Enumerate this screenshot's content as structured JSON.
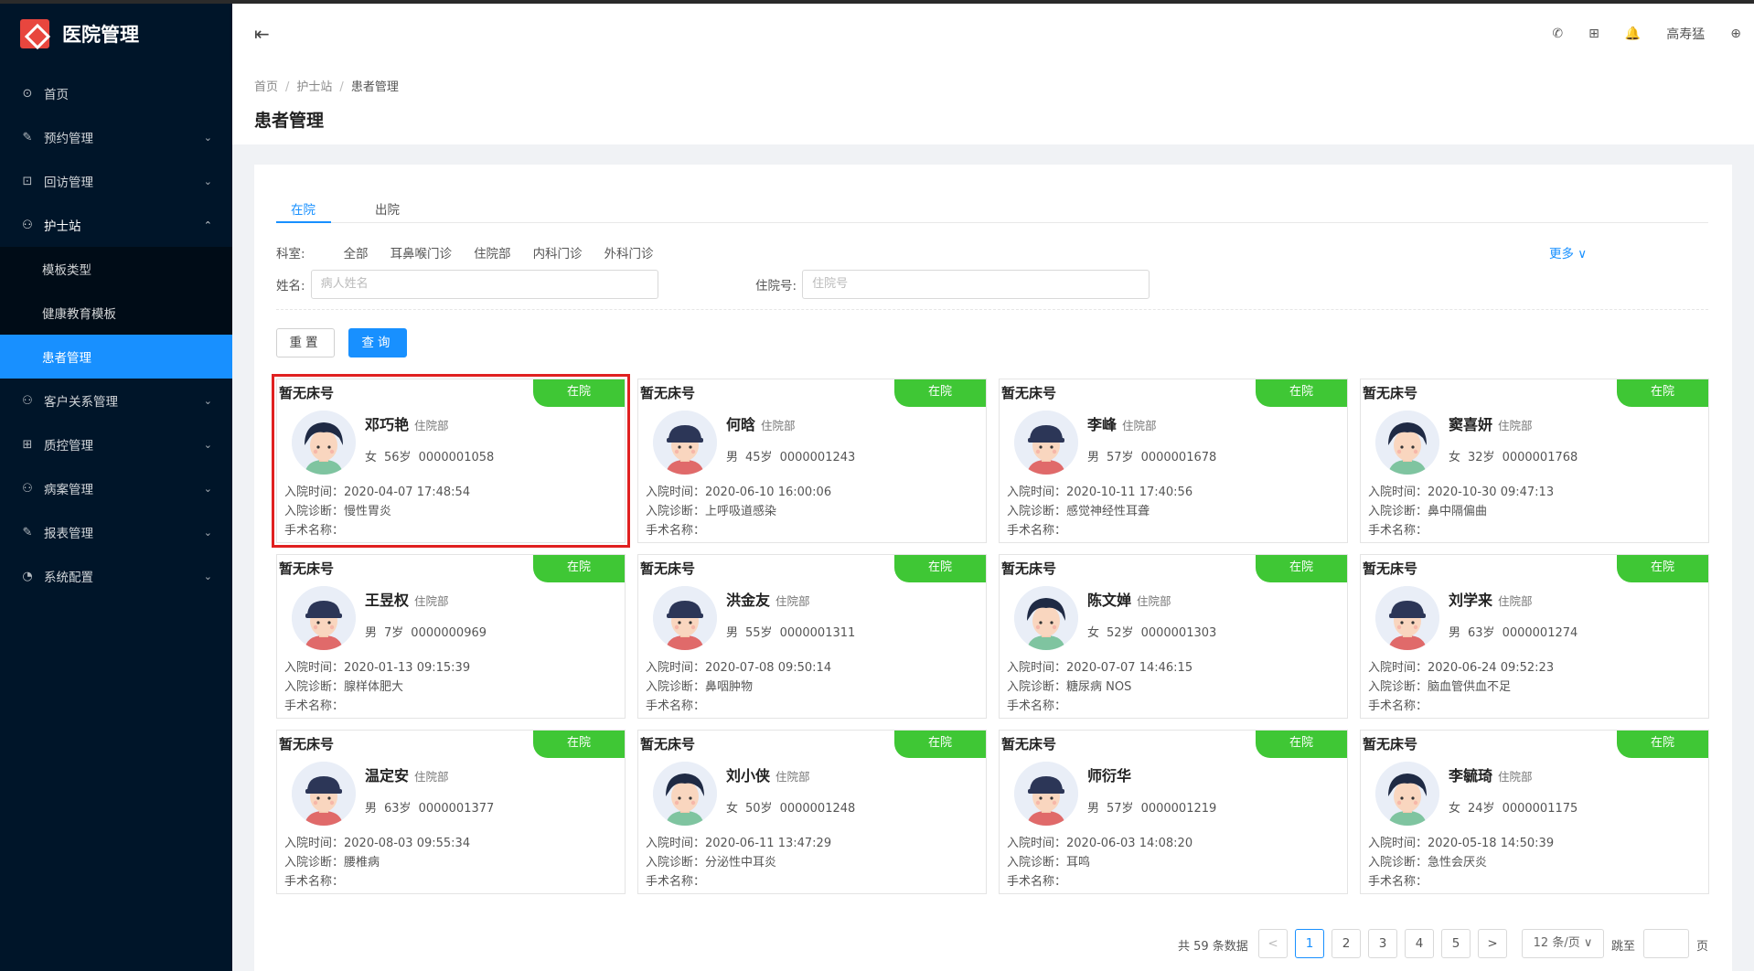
{
  "app": {
    "title": "医院管理"
  },
  "sidebar": {
    "items": [
      {
        "label": "首页",
        "icon": "dashboard-icon",
        "glyph": "⊙",
        "arrow": ""
      },
      {
        "label": "预约管理",
        "icon": "edit-icon",
        "glyph": "✎",
        "arrow": "⌄"
      },
      {
        "label": "回访管理",
        "icon": "lock-icon",
        "glyph": "⊡",
        "arrow": "⌄"
      },
      {
        "label": "护士站",
        "icon": "user-icon",
        "glyph": "⚇",
        "arrow": "⌃"
      },
      {
        "label": "客户关系管理",
        "icon": "user-icon",
        "glyph": "⚇",
        "arrow": "⌄"
      },
      {
        "label": "质控管理",
        "icon": "table-icon",
        "glyph": "⊞",
        "arrow": "⌄"
      },
      {
        "label": "病案管理",
        "icon": "user-icon",
        "glyph": "⚇",
        "arrow": "⌄"
      },
      {
        "label": "报表管理",
        "icon": "edit-icon",
        "glyph": "✎",
        "arrow": "⌄"
      },
      {
        "label": "系统配置",
        "icon": "gauge-icon",
        "glyph": "◔",
        "arrow": "⌄"
      }
    ],
    "nurse_sub": [
      {
        "label": "模板类型"
      },
      {
        "label": "健康教育模板"
      },
      {
        "label": "患者管理"
      }
    ]
  },
  "header": {
    "user": "高寿猛",
    "icons": {
      "phone": "✆",
      "apps": "⊞",
      "bell": "🔔",
      "globe": "⊕"
    }
  },
  "breadcrumb": [
    "首页",
    "护士站",
    "患者管理"
  ],
  "page": {
    "title": "患者管理"
  },
  "tabs": [
    "在院",
    "出院"
  ],
  "filters": {
    "dept_label": "科室:",
    "dept_options": [
      "全部",
      "耳鼻喉门诊",
      "住院部",
      "内科门诊",
      "外科门诊"
    ],
    "more": "更多 ∨",
    "name_label": "姓名:",
    "name_placeholder": "病人姓名",
    "admission_label": "住院号:",
    "admission_placeholder": "住院号"
  },
  "buttons": {
    "reset": "重置",
    "query": "查询"
  },
  "labels": {
    "bed": "暂无床号",
    "status": "在院",
    "admit_time": "入院时间：",
    "admit_diag": "入院诊断：",
    "surgery": "手术名称："
  },
  "patients": [
    {
      "name": "邓巧艳",
      "dept": "住院部",
      "gender": "女",
      "age": "56岁",
      "id": "0000001058",
      "time": "2020-04-07 17:48:54",
      "diag": "慢性胃炎"
    },
    {
      "name": "何晗",
      "dept": "住院部",
      "gender": "男",
      "age": "45岁",
      "id": "0000001243",
      "time": "2020-06-10 16:00:06",
      "diag": "上呼吸道感染"
    },
    {
      "name": "李峰",
      "dept": "住院部",
      "gender": "男",
      "age": "57岁",
      "id": "0000001678",
      "time": "2020-10-11 17:40:56",
      "diag": "感觉神经性耳聋"
    },
    {
      "name": "窦喜妍",
      "dept": "住院部",
      "gender": "女",
      "age": "32岁",
      "id": "0000001768",
      "time": "2020-10-30 09:47:13",
      "diag": "鼻中隔偏曲"
    },
    {
      "name": "王昱权",
      "dept": "住院部",
      "gender": "男",
      "age": "7岁",
      "id": "0000000969",
      "time": "2020-01-13 09:15:39",
      "diag": "腺样体肥大"
    },
    {
      "name": "洪金友",
      "dept": "住院部",
      "gender": "男",
      "age": "55岁",
      "id": "0000001311",
      "time": "2020-07-08 09:50:14",
      "diag": "鼻咽肿物"
    },
    {
      "name": "陈文婵",
      "dept": "住院部",
      "gender": "女",
      "age": "52岁",
      "id": "0000001303",
      "time": "2020-07-07 14:46:15",
      "diag": "糖尿病 NOS"
    },
    {
      "name": "刘学来",
      "dept": "住院部",
      "gender": "男",
      "age": "63岁",
      "id": "0000001274",
      "time": "2020-06-24 09:52:23",
      "diag": "脑血管供血不足"
    },
    {
      "name": "温定安",
      "dept": "住院部",
      "gender": "男",
      "age": "63岁",
      "id": "0000001377",
      "time": "2020-08-03 09:55:34",
      "diag": "腰椎病"
    },
    {
      "name": "刘小侠",
      "dept": "住院部",
      "gender": "女",
      "age": "50岁",
      "id": "0000001248",
      "time": "2020-06-11 13:47:29",
      "diag": "分泌性中耳炎"
    },
    {
      "name": "师衍华",
      "dept": "",
      "gender": "男",
      "age": "57岁",
      "id": "0000001219",
      "time": "2020-06-03 14:08:20",
      "diag": "耳鸣"
    },
    {
      "name": "李毓琦",
      "dept": "住院部",
      "gender": "女",
      "age": "24岁",
      "id": "0000001175",
      "time": "2020-05-18 14:50:39",
      "diag": "急性会厌炎"
    }
  ],
  "pagination": {
    "total": "共 59 条数据",
    "prev": "<",
    "pages": [
      "1",
      "2",
      "3",
      "4",
      "5"
    ],
    "next": ">",
    "page_size": "12 条/页 ∨",
    "jump_label": "跳至",
    "jump_suffix": "页"
  },
  "colors": {
    "accent": "#1890ff",
    "status_green": "#3fc735",
    "sidebar_bg": "#001529",
    "highlight": "#e02020"
  }
}
